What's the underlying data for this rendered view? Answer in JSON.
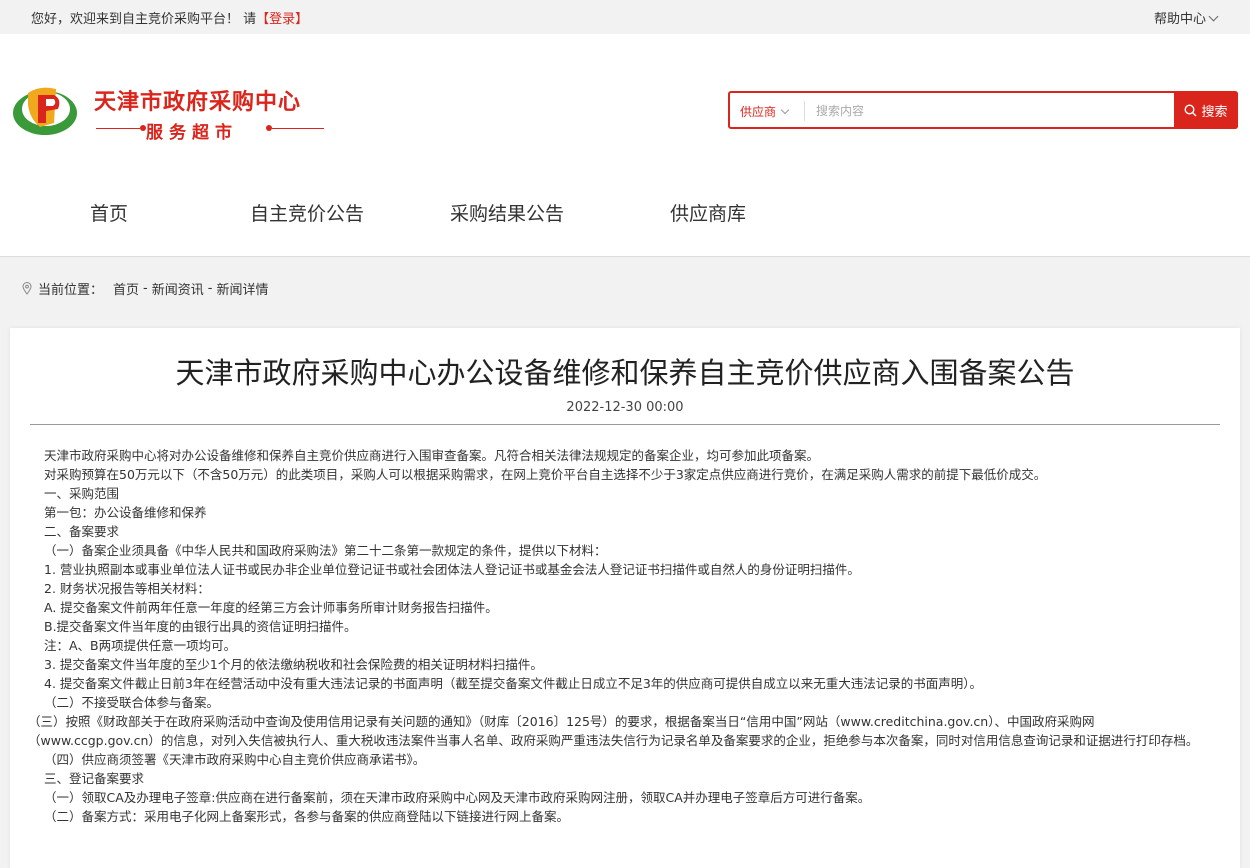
{
  "topbar": {
    "welcome": "您好，欢迎来到自主竞价采购平台！ 请",
    "login": "【登录】",
    "help": "帮助中心"
  },
  "logo": {
    "title": "天津市政府采购中心",
    "subtitle": "服务超市"
  },
  "search": {
    "category": "供应商",
    "placeholder": "搜索内容",
    "button": "搜索"
  },
  "nav": [
    "首页",
    "自主竞价公告",
    "采购结果公告",
    "供应商库"
  ],
  "breadcrumb": {
    "label": "当前位置：",
    "items": [
      "首页",
      "新闻资讯",
      "新闻详情"
    ]
  },
  "article": {
    "title": "天津市政府采购中心办公设备维修和保养自主竞价供应商入围备案公告",
    "date": "2022-12-30 00:00",
    "paragraphs": [
      "天津市政府采购中心将对办公设备维修和保养自主竞价供应商进行入围审查备案。凡符合相关法律法规规定的备案企业，均可参加此项备案。",
      "对采购预算在50万元以下（不含50万元）的此类项目，采购人可以根据采购需求，在网上竞价平台自主选择不少于3家定点供应商进行竞价，在满足采购人需求的前提下最低价成交。",
      "一、采购范围",
      "第一包：办公设备维修和保养",
      "二、备案要求",
      "（一）备案企业须具备《中华人民共和国政府采购法》第二十二条第一款规定的条件，提供以下材料：",
      "1. 营业执照副本或事业单位法人证书或民办非企业单位登记证书或社会团体法人登记证书或基金会法人登记证书扫描件或自然人的身份证明扫描件。",
      "2. 财务状况报告等相关材料：",
      "A. 提交备案文件前两年任意一年度的经第三方会计师事务所审计财务报告扫描件。",
      "B.提交备案文件当年度的由银行出具的资信证明扫描件。",
      "注：A、B两项提供任意一项均可。",
      "3. 提交备案文件当年度的至少1个月的依法缴纳税收和社会保险费的相关证明材料扫描件。",
      "4. 提交备案文件截止日前3年在经营活动中没有重大违法记录的书面声明（截至提交备案文件截止日成立不足3年的供应商可提供自成立以来无重大违法记录的书面声明）。",
      "（二）不接受联合体参与备案。",
      "（三）按照《财政部关于在政府采购活动中查询及使用信用记录有关问题的通知》（财库〔2016〕125号）的要求，根据备案当日“信用中国”网站（www.creditchina.gov.cn）、中国政府采购网（www.ccgp.gov.cn）的信息，对列入失信被执行人、重大税收违法案件当事人名单、政府采购严重违法失信行为记录名单及备案要求的企业，拒绝参与本次备案，同时对信用信息查询记录和证据进行打印存档。",
      "（四）供应商须签署《天津市政府采购中心自主竞价供应商承诺书》。",
      "三、登记备案要求",
      "（一）领取CA及办理电子签章:供应商在进行备案前，须在天津市政府采购中心网及天津市政府采购网注册，领取CA并办理电子签章后方可进行备案。",
      "（二）备案方式：采用电子化网上备案形式，各参与备案的供应商登陆以下链接进行网上备案。"
    ]
  }
}
